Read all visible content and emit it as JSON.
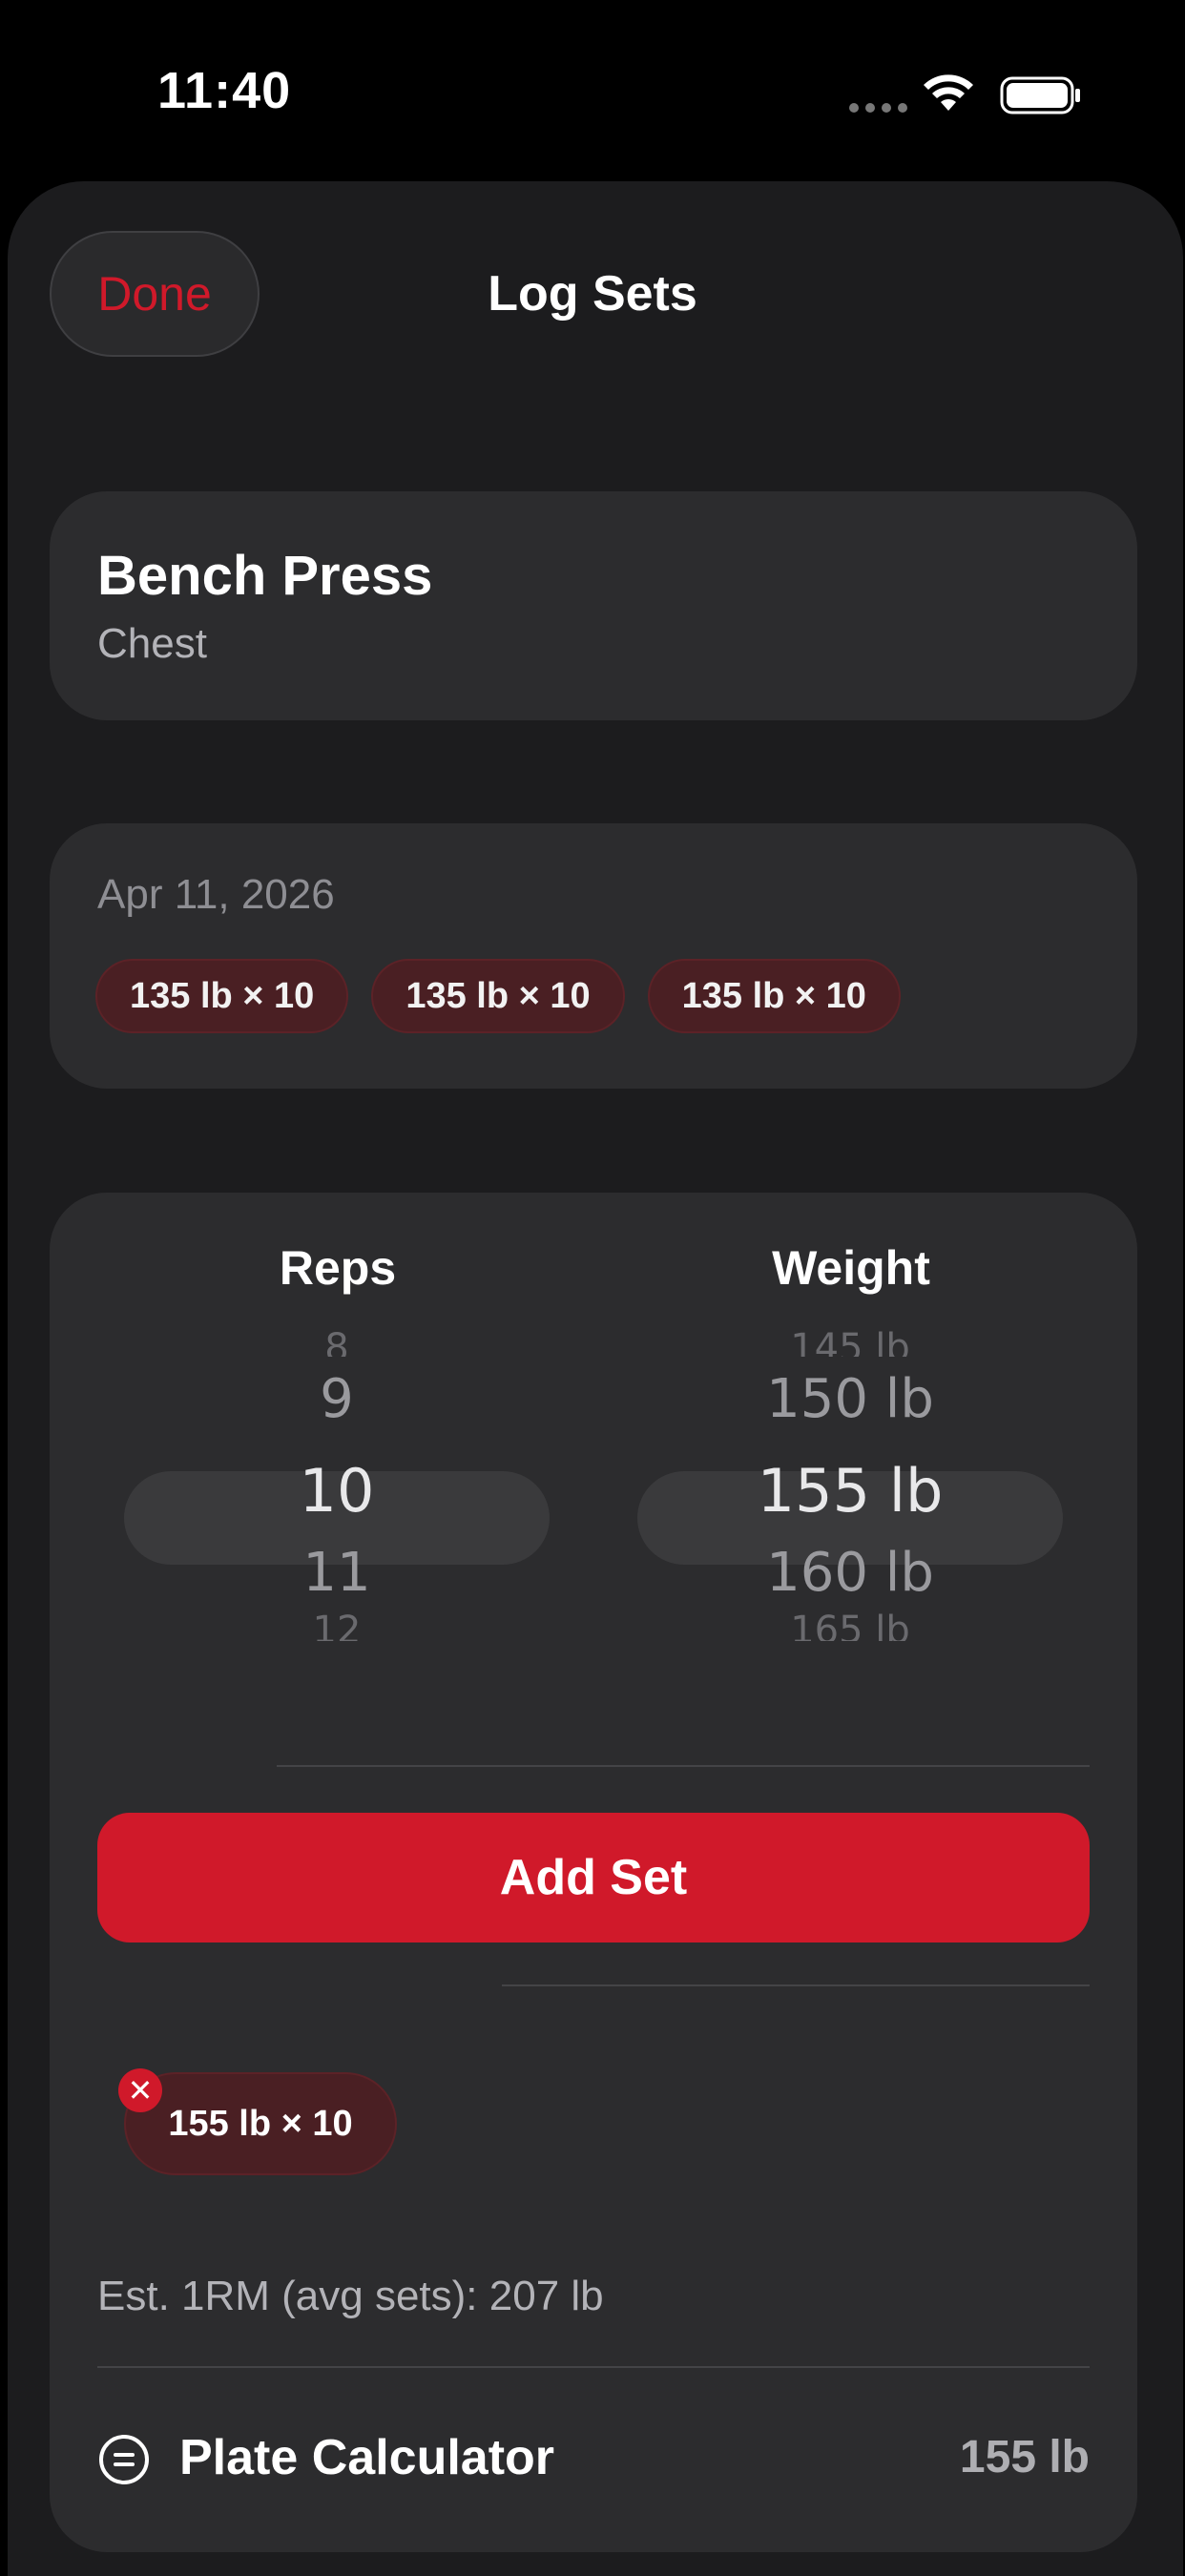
{
  "status_bar": {
    "time": "11:40"
  },
  "nav": {
    "done_label": "Done",
    "title": "Log Sets"
  },
  "exercise": {
    "name": "Bench Press",
    "muscle_group": "Chest"
  },
  "history": {
    "date": "Apr 11, 2026",
    "sets": [
      "135 lb × 10",
      "135 lb × 10",
      "135 lb × 10"
    ]
  },
  "picker": {
    "reps_label": "Reps",
    "weight_label": "Weight",
    "reps": {
      "above2": "8",
      "above1": "9",
      "selected": "10",
      "below1": "11",
      "below2": "12"
    },
    "weight": {
      "above2": "145 lb",
      "above1": "150 lb",
      "selected": "155 lb",
      "below1": "160 lb",
      "below2": "165 lb"
    }
  },
  "add_set_label": "Add Set",
  "current_sets": [
    "155 lb × 10"
  ],
  "remove_glyph": "✕",
  "estimate": "Est. 1RM (avg sets): 207 lb",
  "plate_calculator": {
    "label": "Plate Calculator",
    "value": "155 lb"
  },
  "colors": {
    "accent": "#d0192a",
    "chip_bg": "#4a1f23",
    "card_bg": "#2c2c2e",
    "sheet_bg": "#1c1c1e"
  }
}
